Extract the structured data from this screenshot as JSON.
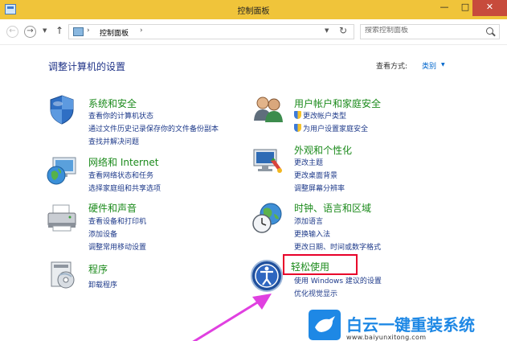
{
  "window": {
    "title": "控制面板",
    "minimize_glyph": "—",
    "maximize_glyph": "□",
    "close_glyph": "✕"
  },
  "address": {
    "back_glyph": "←",
    "forward_glyph": "→",
    "up_glyph": "↑",
    "path_sep": "›",
    "path": "控制面板",
    "refresh_glyph": "↻",
    "dropdown_glyph": "▼"
  },
  "search": {
    "placeholder": "搜索控制面板"
  },
  "page": {
    "heading": "调整计算机的设置",
    "view_by_label": "查看方式:",
    "view_by_value": "类别"
  },
  "categories": [
    {
      "icon": "shield-flag-icon",
      "title": "系统和安全",
      "links": [
        "查看你的计算机状态",
        "通过文件历史记录保存你的文件备份副本",
        "查找并解决问题"
      ]
    },
    {
      "icon": "globe-network-icon",
      "title": "网络和 Internet",
      "links": [
        "查看网络状态和任务",
        "选择家庭组和共享选项"
      ]
    },
    {
      "icon": "printer-icon",
      "title": "硬件和声音",
      "links": [
        "查看设备和打印机",
        "添加设备",
        "调整常用移动设置"
      ]
    },
    {
      "icon": "programs-icon",
      "title": "程序",
      "links": [
        "卸载程序"
      ]
    },
    {
      "icon": "users-icon",
      "title": "用户帐户和家庭安全",
      "links": [
        "更改帐户类型",
        "为用户设置家庭安全"
      ]
    },
    {
      "icon": "appearance-icon",
      "title": "外观和个性化",
      "links": [
        "更改主题",
        "更改桌面背景",
        "调整屏幕分辨率"
      ]
    },
    {
      "icon": "clock-globe-icon",
      "title": "时钟、语言和区域",
      "links": [
        "添加语言",
        "更换输入法",
        "更改日期、时间或数字格式"
      ]
    },
    {
      "icon": "ease-of-access-icon",
      "title": "轻松使用",
      "links": [
        "使用 Windows 建议的设置",
        "优化视觉显示"
      ]
    }
  ],
  "watermark": {
    "name": "白云一键重装系统",
    "url": "www.baiyunxitong.com"
  },
  "colors": {
    "titlebar": "#f0c43a",
    "category_title": "#1b8a1b",
    "link": "#1e3a8a",
    "highlight_box": "#e8002a",
    "arrow": "#e040e0",
    "brand": "#1e88e5"
  }
}
